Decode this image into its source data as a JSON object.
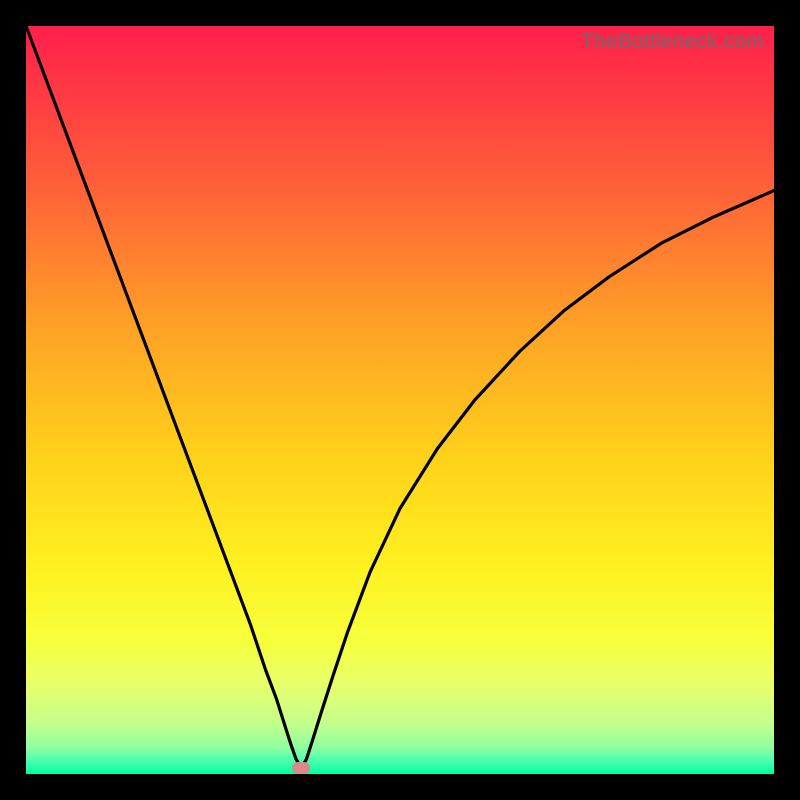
{
  "watermark": "TheBottleneck.com",
  "colors": {
    "frame": "#000000",
    "curve": "#000000",
    "marker": "#d98a86",
    "gradient_stops": [
      {
        "offset": 0.0,
        "color": "#ff1f4b"
      },
      {
        "offset": 0.2,
        "color": "#ff5b3a"
      },
      {
        "offset": 0.4,
        "color": "#ffa126"
      },
      {
        "offset": 0.58,
        "color": "#ffd21a"
      },
      {
        "offset": 0.72,
        "color": "#fff020"
      },
      {
        "offset": 0.82,
        "color": "#f7ff3a"
      },
      {
        "offset": 0.88,
        "color": "#e8ff6a"
      },
      {
        "offset": 0.93,
        "color": "#c6ff8a"
      },
      {
        "offset": 0.965,
        "color": "#8fffa0"
      },
      {
        "offset": 0.985,
        "color": "#3fffb0"
      },
      {
        "offset": 1.0,
        "color": "#00ff99"
      }
    ]
  },
  "chart_data": {
    "type": "line",
    "title": "",
    "xlabel": "",
    "ylabel": "",
    "xlim": [
      0,
      100
    ],
    "ylim": [
      0,
      100
    ],
    "grid": false,
    "marker": {
      "x": 36.8,
      "y": 0.8
    },
    "series": [
      {
        "name": "bottleneck-curve",
        "x": [
          0.0,
          3.0,
          6.0,
          9.0,
          12.0,
          15.0,
          18.0,
          21.0,
          24.0,
          27.0,
          30.0,
          32.0,
          33.5,
          34.6,
          35.4,
          36.1,
          36.8,
          37.5,
          38.3,
          39.4,
          41.0,
          43.0,
          46.0,
          50.0,
          55.0,
          60.0,
          66.0,
          72.0,
          78.0,
          85.0,
          92.0,
          100.0
        ],
        "y": [
          100.0,
          92.0,
          84.0,
          76.0,
          68.0,
          60.0,
          52.0,
          44.0,
          36.0,
          28.0,
          20.0,
          14.0,
          10.0,
          6.5,
          4.0,
          2.0,
          0.8,
          2.0,
          4.5,
          8.0,
          13.0,
          19.0,
          27.0,
          35.5,
          43.5,
          50.0,
          56.5,
          62.0,
          66.5,
          71.0,
          74.5,
          78.0
        ]
      }
    ]
  }
}
